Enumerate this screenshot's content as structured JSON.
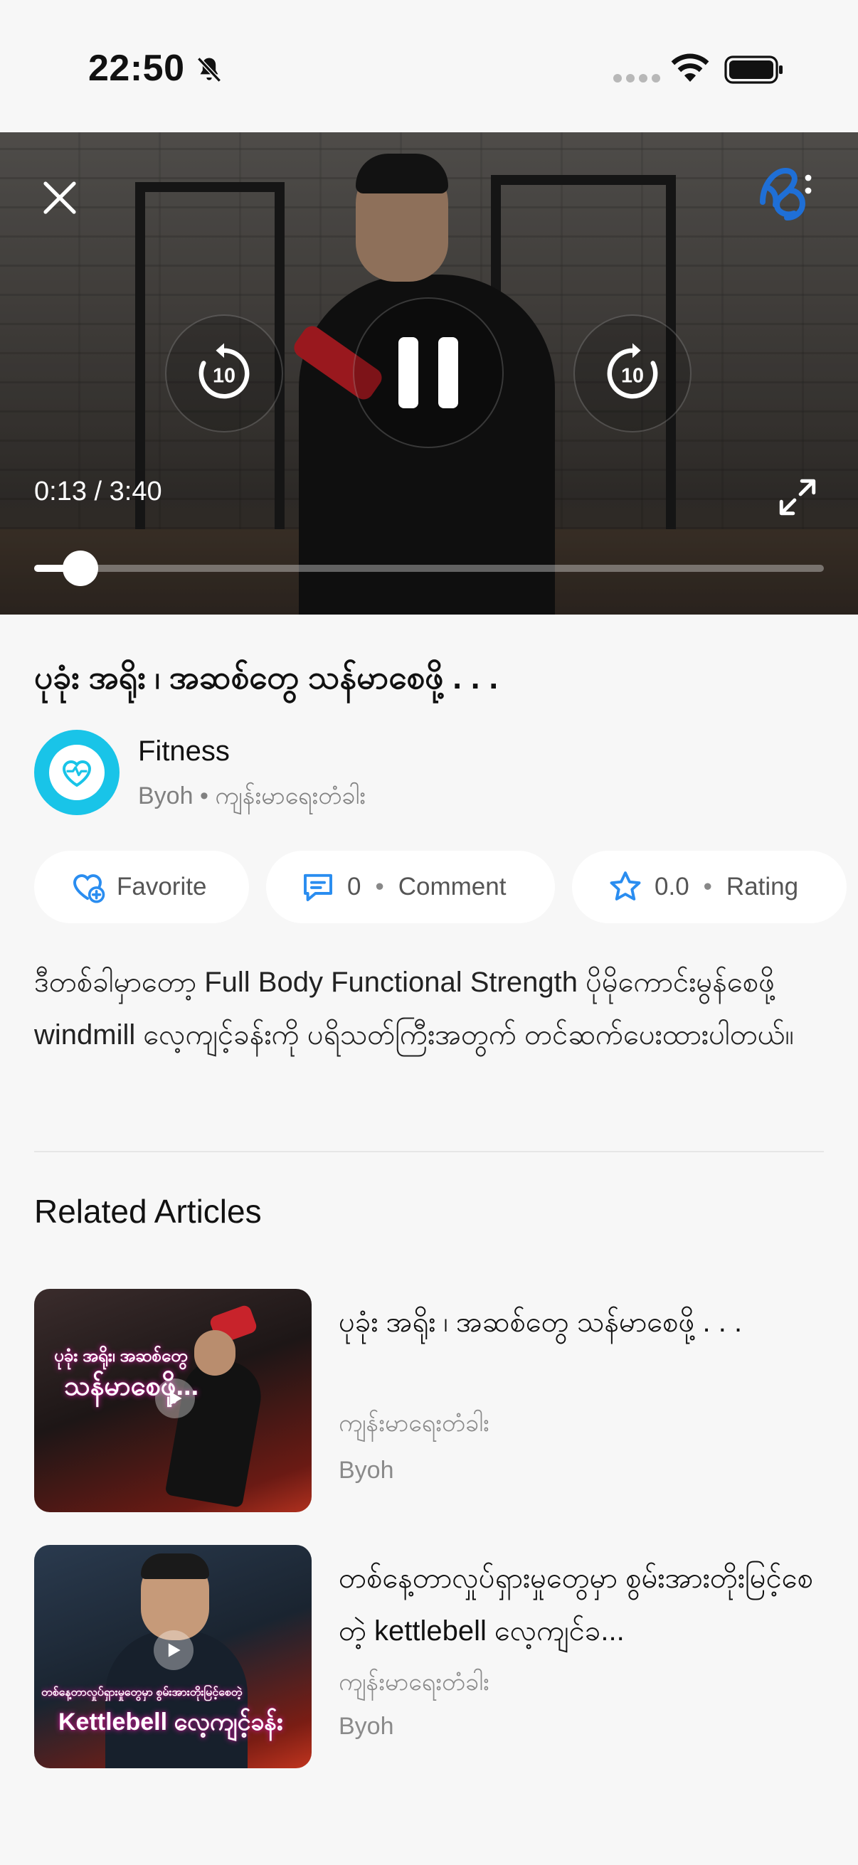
{
  "status_bar": {
    "time": "22:50"
  },
  "player": {
    "current_time": "0:13",
    "duration": "3:40",
    "time_display": "0:13 / 3:40",
    "progress_fraction": 0.059,
    "rewind_seconds": "10",
    "forward_seconds": "10"
  },
  "video": {
    "title": "ပုခုံး အရိုး ၊ အဆစ်တွေ သန်မာစေဖို့ . . .",
    "category_name": "Fitness",
    "category_sub": "Byoh • ကျန်းမာရေးတံခါး",
    "accent_color": "#19c4e8"
  },
  "actions": {
    "favorite_label": "Favorite",
    "comment_count": "0",
    "comment_label": "Comment",
    "rating_value": "0.0",
    "rating_label": "Rating",
    "separator": "•"
  },
  "description": "ဒီတစ်ခါမှာတော့ Full Body Functional Strength ပိုမိုကောင်းမွန်စေဖို့ windmill လေ့ကျင့်ခန်းကို ပရိသတ်ကြီးအတွက် တင်ဆက်ပေးထားပါတယ်။",
  "related": {
    "heading": "Related Articles",
    "articles": [
      {
        "title": "ပုခုံး အရိုး ၊ အဆစ်တွေ သန်မာစေဖို့ . . .",
        "category": "ကျန်းမာရေးတံခါး",
        "author": "Byoh",
        "thumb_line1": "ပုခုံး အရိုး၊ အဆစ်တွေ",
        "thumb_line2": "သန်မာစေဖို့..."
      },
      {
        "title": "တစ်နေ့တာလှုပ်ရှားမှုတွေမှာ စွမ်းအားတိုးမြင့်စေတဲ့ kettlebell လေ့ကျင်ခ...",
        "category": "ကျန်းမာရေးတံခါး",
        "author": "Byoh",
        "thumb_line1": "တစ်နေ့တာလှုပ်ရှားမှုတွေမှာ စွမ်းအားတိုးမြင့်စေတဲ့",
        "thumb_line2": "Kettlebell လေ့ကျင့်ခန်း"
      }
    ]
  }
}
